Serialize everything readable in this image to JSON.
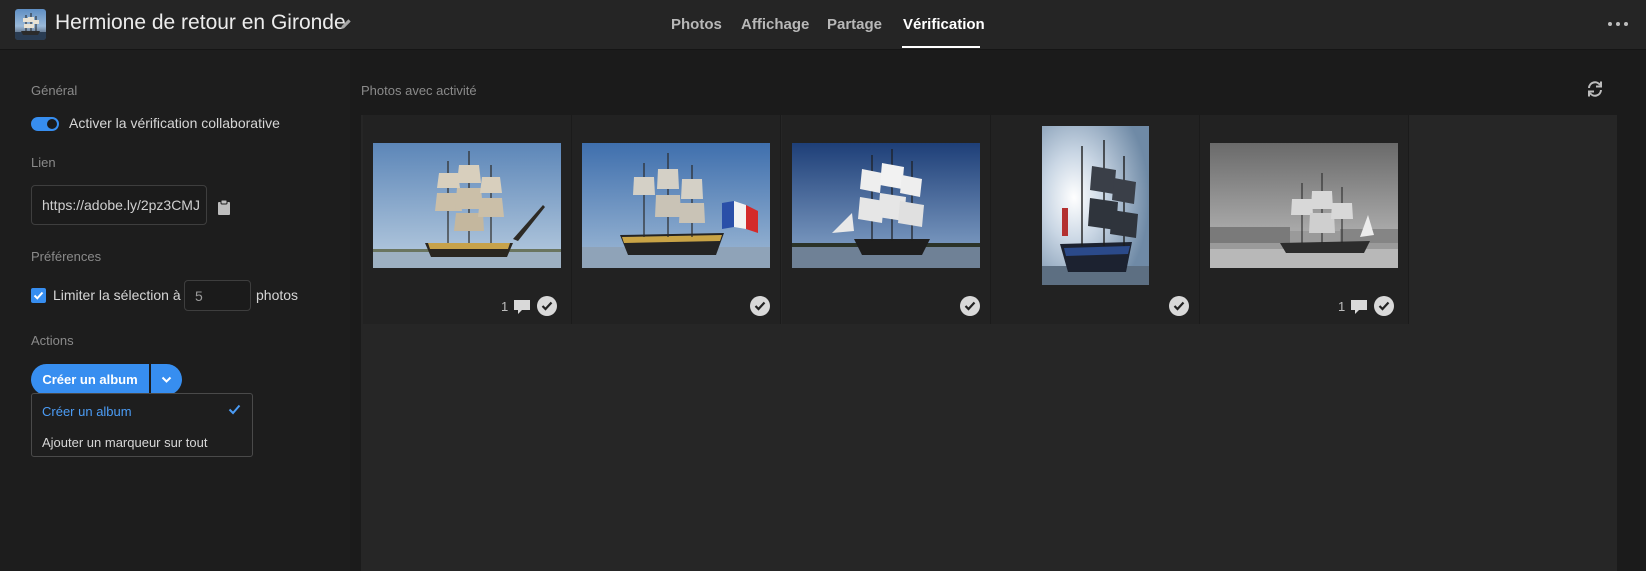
{
  "header": {
    "album_title": "Hermione de retour en Gironde",
    "tabs": [
      "Photos",
      "Affichage",
      "Partage",
      "Vérification"
    ],
    "active_tab": "Vérification"
  },
  "sidebar": {
    "general_label": "Général",
    "collab_toggle_label": "Activer la vérification collaborative",
    "collab_toggle_on": true,
    "link_label": "Lien",
    "link_value": "https://adobe.ly/2pz3CMJ",
    "preferences_label": "Préférences",
    "limit_checked": true,
    "limit_label": "Limiter la sélection à",
    "limit_value": "5",
    "limit_suffix": "photos",
    "actions_label": "Actions",
    "primary_action": "Créer un album",
    "menu_items": [
      "Créer un album",
      "Ajouter un marqueur sur tout"
    ],
    "menu_selected": "Créer un album"
  },
  "main": {
    "activity_label": "Photos avec activité",
    "photos": [
      {
        "comments": "1",
        "orientation": "landscape",
        "style": "color"
      },
      {
        "comments": "",
        "orientation": "landscape",
        "style": "color-flag"
      },
      {
        "comments": "",
        "orientation": "landscape",
        "style": "color"
      },
      {
        "comments": "",
        "orientation": "portrait",
        "style": "backlit"
      },
      {
        "comments": "1",
        "orientation": "landscape",
        "style": "bw"
      }
    ]
  },
  "colors": {
    "accent": "#378ef0",
    "background": "#1b1b1b",
    "topbar": "#252525"
  },
  "icons": [
    "edit-icon",
    "more-icon",
    "clipboard-icon",
    "chevron-down-icon",
    "checkmark-icon",
    "refresh-icon",
    "comment-icon",
    "check-circle-icon"
  ]
}
